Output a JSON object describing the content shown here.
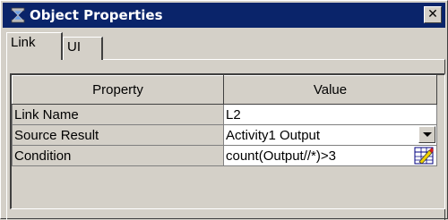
{
  "window": {
    "title": "Object Properties",
    "close_label": "✕"
  },
  "tabs": [
    {
      "label": "Link",
      "active": true
    },
    {
      "label": "UI",
      "active": false
    }
  ],
  "grid": {
    "headers": [
      "Property",
      "Value"
    ],
    "rows": [
      {
        "property": "Link Name",
        "value": "L2",
        "control": "none"
      },
      {
        "property": "Source Result",
        "value": "Activity1 Output",
        "control": "dropdown"
      },
      {
        "property": "Condition",
        "value": "count(Output//*)>3",
        "control": "expression-editor"
      }
    ]
  },
  "icons": {
    "title": "hourglass-icon",
    "dropdown": "chevron-down-icon",
    "expression": "expression-editor-icon"
  },
  "colors": {
    "titlebar": "#0a246a",
    "face": "#d4d0c8",
    "cell": "#ffffff"
  }
}
